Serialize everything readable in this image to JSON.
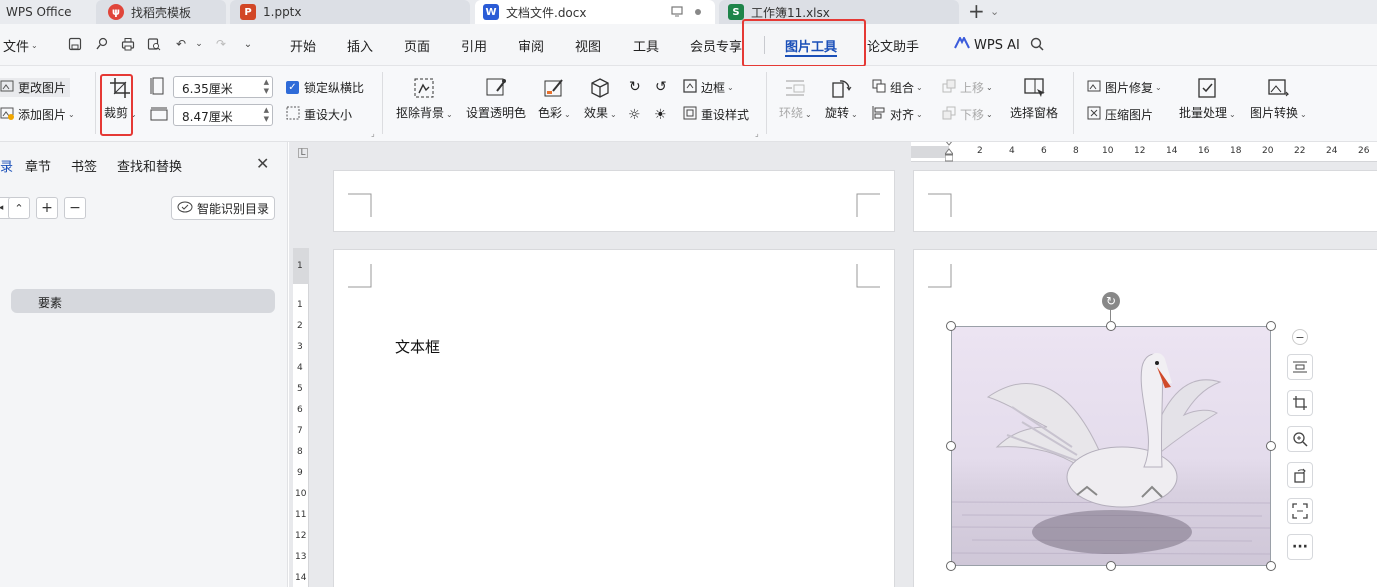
{
  "tabs": [
    {
      "label": "WPS Office",
      "icon": "wps-logo"
    },
    {
      "label": "找稻壳模板",
      "icon": "docer-icon"
    },
    {
      "label": "1.pptx",
      "icon": "ppt-icon",
      "badge": "P"
    },
    {
      "label": "文档文件.docx",
      "icon": "word-icon",
      "badge": "W"
    },
    {
      "label": "工作簿11.xlsx",
      "icon": "excel-icon",
      "badge": "S"
    }
  ],
  "new_tab": "+",
  "menu": {
    "file": "文件",
    "items": [
      "开始",
      "插入",
      "页面",
      "引用",
      "审阅",
      "视图",
      "工具",
      "会员专享",
      "图片工具",
      "论文助手"
    ],
    "active": "图片工具",
    "wps_ai": "WPS AI"
  },
  "ribbon": {
    "change_image": "更改图片",
    "add_image": "添加图片",
    "crop": "裁剪",
    "width_value": "6.35厘米",
    "height_value": "8.47厘米",
    "lock_ratio": "锁定纵横比",
    "reset_size": "重设大小",
    "remove_bg": "抠除背景",
    "set_transparent": "设置透明色",
    "color": "色彩",
    "effects": "效果",
    "border": "边框",
    "reset_style": "重设样式",
    "wrap": "环绕",
    "rotate": "旋转",
    "group": "组合",
    "align": "对齐",
    "bring_forward": "上移",
    "send_backward": "下移",
    "selection_pane": "选择窗格",
    "image_repair": "图片修复",
    "compress": "压缩图片",
    "batch": "批量处理",
    "convert": "图片转换"
  },
  "nav": {
    "tabs": [
      "录",
      "章节",
      "书签",
      "查找和替换"
    ],
    "smart_toc": "智能识别目录",
    "item": "要素"
  },
  "ruler": {
    "h_ticks": [
      "2",
      "4",
      "6",
      "8",
      "10",
      "12",
      "14",
      "16",
      "18",
      "20",
      "22",
      "24",
      "26"
    ],
    "v_ticks": [
      "1",
      "2",
      "3",
      "4",
      "5",
      "6",
      "7",
      "8",
      "9",
      "10",
      "11",
      "12",
      "13",
      "14"
    ],
    "v_top": "1"
  },
  "document": {
    "textbox_text": "文本框"
  },
  "colors": {
    "accent": "#1a4fb8",
    "highlight": "#e53935",
    "word": "#2b5cd6",
    "ppt": "#d24726",
    "excel": "#1e8449",
    "docer": "#e0453a"
  }
}
